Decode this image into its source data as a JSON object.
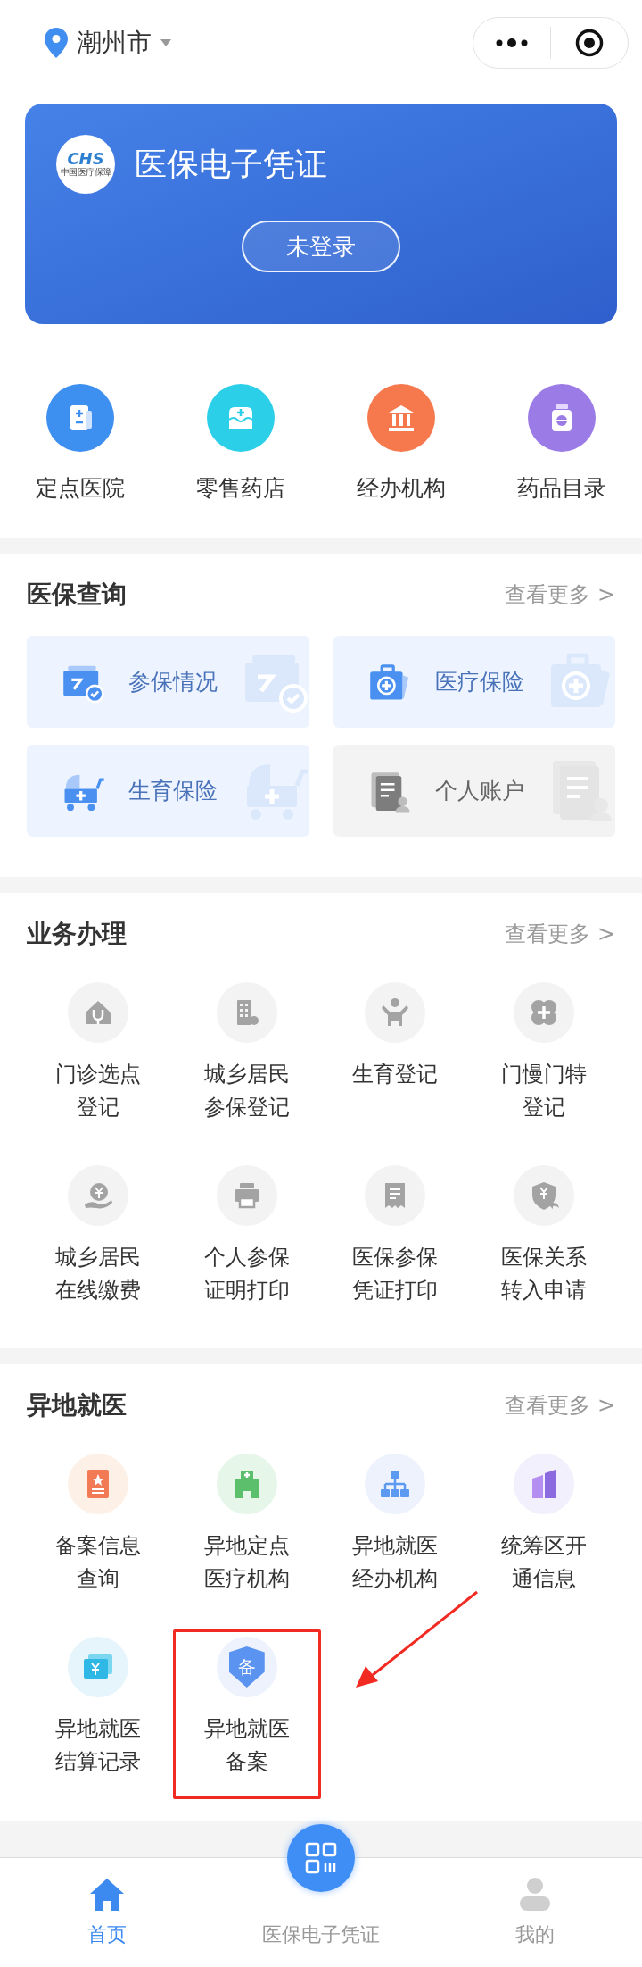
{
  "header": {
    "location": "潮州市"
  },
  "card": {
    "logo": {
      "mark": "CHS",
      "name": "中国医疗保障"
    },
    "title": "医保电子凭证",
    "login_button": "未登录"
  },
  "quick_links": [
    {
      "label": "定点医院",
      "color": "#3d8ff0"
    },
    {
      "label": "零售药店",
      "color": "#2ccfe8"
    },
    {
      "label": "经办机构",
      "color": "#f6794e"
    },
    {
      "label": "药品目录",
      "color": "#9b7ce6"
    }
  ],
  "query": {
    "title": "医保查询",
    "more": "查看更多 >",
    "items": [
      {
        "label": "参保情况",
        "disabled": false
      },
      {
        "label": "医疗保险",
        "disabled": false
      },
      {
        "label": "生育保险",
        "disabled": false
      },
      {
        "label": "个人账户",
        "disabled": true
      }
    ]
  },
  "business": {
    "title": "业务办理",
    "more": "查看更多 >",
    "items": [
      {
        "label": "门诊选点登记"
      },
      {
        "label": "城乡居民参保登记"
      },
      {
        "label": "生育登记"
      },
      {
        "label": "门慢门特登记"
      },
      {
        "label": "城乡居民在线缴费"
      },
      {
        "label": "个人参保证明打印"
      },
      {
        "label": "医保参保凭证打印"
      },
      {
        "label": "医保关系转入申请"
      }
    ]
  },
  "remote": {
    "title": "异地就医",
    "more": "查看更多 >",
    "items": [
      {
        "label": "备案信息查询",
        "highlighted": false
      },
      {
        "label": "异地定点医疗机构",
        "highlighted": false
      },
      {
        "label": "异地就医经办机构",
        "highlighted": false
      },
      {
        "label": "统筹区开通信息",
        "highlighted": false
      },
      {
        "label": "异地就医结算记录",
        "highlighted": false
      },
      {
        "label": "异地就医备案",
        "highlighted": true,
        "badge": "备"
      }
    ]
  },
  "nav": [
    {
      "kind": "tab",
      "label": "首页",
      "selected": true
    },
    {
      "kind": "center",
      "label": "医保电子凭证",
      "selected": false
    },
    {
      "kind": "tab",
      "label": "我的",
      "selected": false
    }
  ]
}
